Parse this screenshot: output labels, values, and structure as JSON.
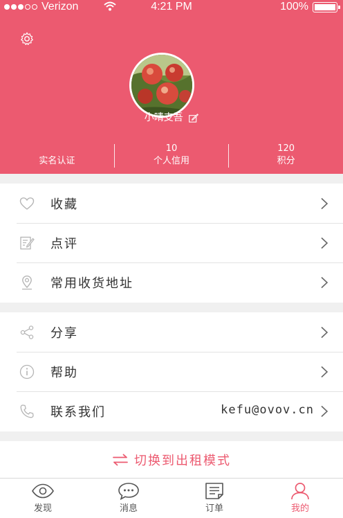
{
  "statusbar": {
    "carrier": "Verizon",
    "time": "4:21 PM",
    "battery": "100%"
  },
  "profile": {
    "username": "小晴支吾",
    "stats": [
      {
        "label": "实名认证",
        "value": ""
      },
      {
        "label": "个人信用",
        "value": "10"
      },
      {
        "label": "积分",
        "value": "120"
      }
    ]
  },
  "menu_group_1": [
    {
      "label": "收藏",
      "icon": "heart-icon"
    },
    {
      "label": "点评",
      "icon": "review-icon"
    },
    {
      "label": "常用收货地址",
      "icon": "location-icon"
    }
  ],
  "menu_group_2": [
    {
      "label": "分享",
      "icon": "share-icon"
    },
    {
      "label": "帮助",
      "icon": "info-icon"
    },
    {
      "label": "联系我们",
      "icon": "phone-icon",
      "value": "kefu@ovov.cn"
    }
  ],
  "switch_mode": {
    "label": "切换到出租模式"
  },
  "tabbar": [
    {
      "label": "发现",
      "icon": "eye-icon"
    },
    {
      "label": "消息",
      "icon": "message-icon"
    },
    {
      "label": "订单",
      "icon": "order-icon"
    },
    {
      "label": "我的",
      "icon": "person-icon",
      "active": true
    }
  ],
  "colors": {
    "accent": "#ec5a70",
    "background": "#f0f0f0"
  }
}
